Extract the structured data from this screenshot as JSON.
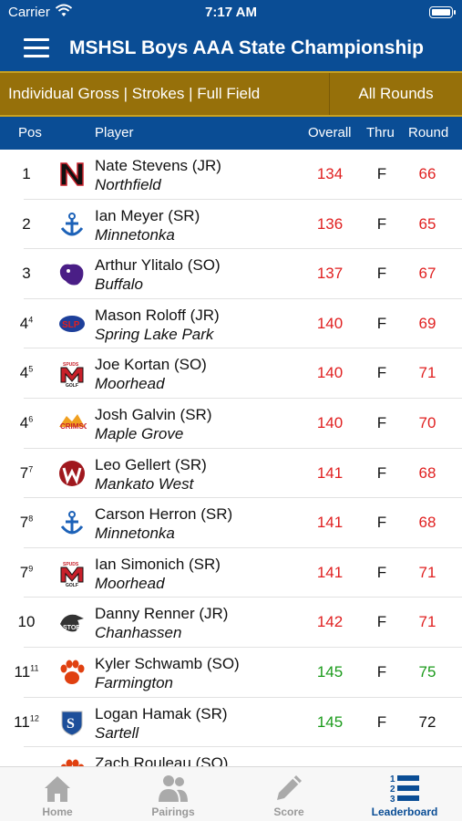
{
  "status": {
    "carrier": "Carrier",
    "time": "7:17 AM"
  },
  "navbar": {
    "title": "MSHSL Boys AAA State Championship"
  },
  "filters": {
    "left": "Individual Gross | Strokes | Full Field",
    "right": "All Rounds"
  },
  "columns": {
    "pos": "Pos",
    "player": "Player",
    "overall": "Overall",
    "thru": "Thru",
    "round": "Round"
  },
  "colors": {
    "primary": "#0a4d95",
    "filter_bar": "#96700a",
    "over_par": "#e02020",
    "under_par": "#1a9a1a",
    "even": "#111111",
    "tab_inactive": "#999999"
  },
  "rows": [
    {
      "pos": "1",
      "tie": "",
      "name": "Nate Stevens (JR)",
      "school": "Northfield",
      "overall": "134",
      "thru": "F",
      "round": "66",
      "overall_color": "#e02020",
      "round_color": "#e02020",
      "logo": "northfield-logo"
    },
    {
      "pos": "2",
      "tie": "",
      "name": "Ian Meyer (SR)",
      "school": "Minnetonka",
      "overall": "136",
      "thru": "F",
      "round": "65",
      "overall_color": "#e02020",
      "round_color": "#e02020",
      "logo": "minnetonka-logo"
    },
    {
      "pos": "3",
      "tie": "",
      "name": "Arthur Ylitalo (SO)",
      "school": "Buffalo",
      "overall": "137",
      "thru": "F",
      "round": "67",
      "overall_color": "#e02020",
      "round_color": "#e02020",
      "logo": "buffalo-logo"
    },
    {
      "pos": "4",
      "tie": "4",
      "name": "Mason Roloff (JR)",
      "school": "Spring Lake Park",
      "overall": "140",
      "thru": "F",
      "round": "69",
      "overall_color": "#e02020",
      "round_color": "#e02020",
      "logo": "spring-lake-park-logo"
    },
    {
      "pos": "4",
      "tie": "5",
      "name": "Joe Kortan (SO)",
      "school": "Moorhead",
      "overall": "140",
      "thru": "F",
      "round": "71",
      "overall_color": "#e02020",
      "round_color": "#e02020",
      "logo": "moorhead-logo"
    },
    {
      "pos": "4",
      "tie": "6",
      "name": "Josh Galvin (SR)",
      "school": "Maple Grove",
      "overall": "140",
      "thru": "F",
      "round": "70",
      "overall_color": "#e02020",
      "round_color": "#e02020",
      "logo": "maple-grove-logo"
    },
    {
      "pos": "7",
      "tie": "7",
      "name": "Leo Gellert (SR)",
      "school": "Mankato West",
      "overall": "141",
      "thru": "F",
      "round": "68",
      "overall_color": "#e02020",
      "round_color": "#e02020",
      "logo": "mankato-west-logo"
    },
    {
      "pos": "7",
      "tie": "8",
      "name": "Carson Herron (SR)",
      "school": "Minnetonka",
      "overall": "141",
      "thru": "F",
      "round": "68",
      "overall_color": "#e02020",
      "round_color": "#e02020",
      "logo": "minnetonka-logo"
    },
    {
      "pos": "7",
      "tie": "9",
      "name": "Ian Simonich (SR)",
      "school": "Moorhead",
      "overall": "141",
      "thru": "F",
      "round": "71",
      "overall_color": "#e02020",
      "round_color": "#e02020",
      "logo": "moorhead-logo"
    },
    {
      "pos": "10",
      "tie": "",
      "name": "Danny Renner (JR)",
      "school": "Chanhassen",
      "overall": "142",
      "thru": "F",
      "round": "71",
      "overall_color": "#e02020",
      "round_color": "#e02020",
      "logo": "chanhassen-logo"
    },
    {
      "pos": "11",
      "tie": "11",
      "name": "Kyler Schwamb (SO)",
      "school": "Farmington",
      "overall": "145",
      "thru": "F",
      "round": "75",
      "overall_color": "#1a9a1a",
      "round_color": "#1a9a1a",
      "logo": "farmington-logo"
    },
    {
      "pos": "11",
      "tie": "12",
      "name": "Logan Hamak (SR)",
      "school": "Sartell",
      "overall": "145",
      "thru": "F",
      "round": "72",
      "overall_color": "#1a9a1a",
      "round_color": "#111111",
      "logo": "sartell-logo"
    },
    {
      "pos": "",
      "tie": "",
      "name": "Zach Rouleau (SO)",
      "school": "",
      "overall": "",
      "thru": "",
      "round": "",
      "overall_color": "#1a9a1a",
      "round_color": "#111111",
      "logo": "farmington-logo"
    }
  ],
  "tabs": [
    {
      "label": "Home",
      "icon": "home-icon",
      "active": false
    },
    {
      "label": "Pairings",
      "icon": "people-icon",
      "active": false
    },
    {
      "label": "Score",
      "icon": "pencil-icon",
      "active": false
    },
    {
      "label": "Leaderboard",
      "icon": "leaderboard-icon",
      "active": true
    }
  ]
}
